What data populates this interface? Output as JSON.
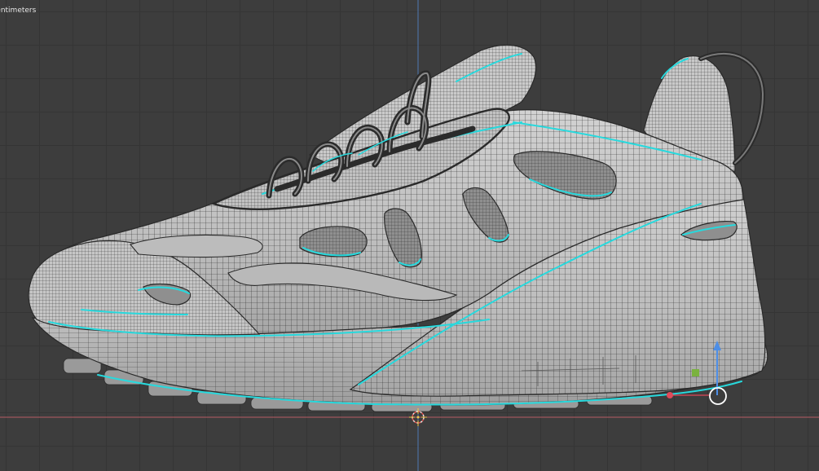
{
  "viewport": {
    "units_label": "Centimeters",
    "background_color": "#3d3d3d",
    "grid_color": "#353535",
    "axis_x_color": "#b85a63",
    "axis_z_color": "#4f79b4",
    "mesh_base_color": "#c4c4c4",
    "wire_color": "#2a2a2a",
    "seam_color": "#27d9dd"
  },
  "scene": {
    "object": "sneaker-mesh",
    "mode": "edit-wireframe-overlay",
    "cursor": "3d-cursor-icon",
    "gizmo": {
      "x_axis_color": "#e04a5a",
      "y_axis_color": "#7ab23f",
      "z_axis_color": "#4d8ee6",
      "handle": "gizmo-center-circle"
    }
  }
}
